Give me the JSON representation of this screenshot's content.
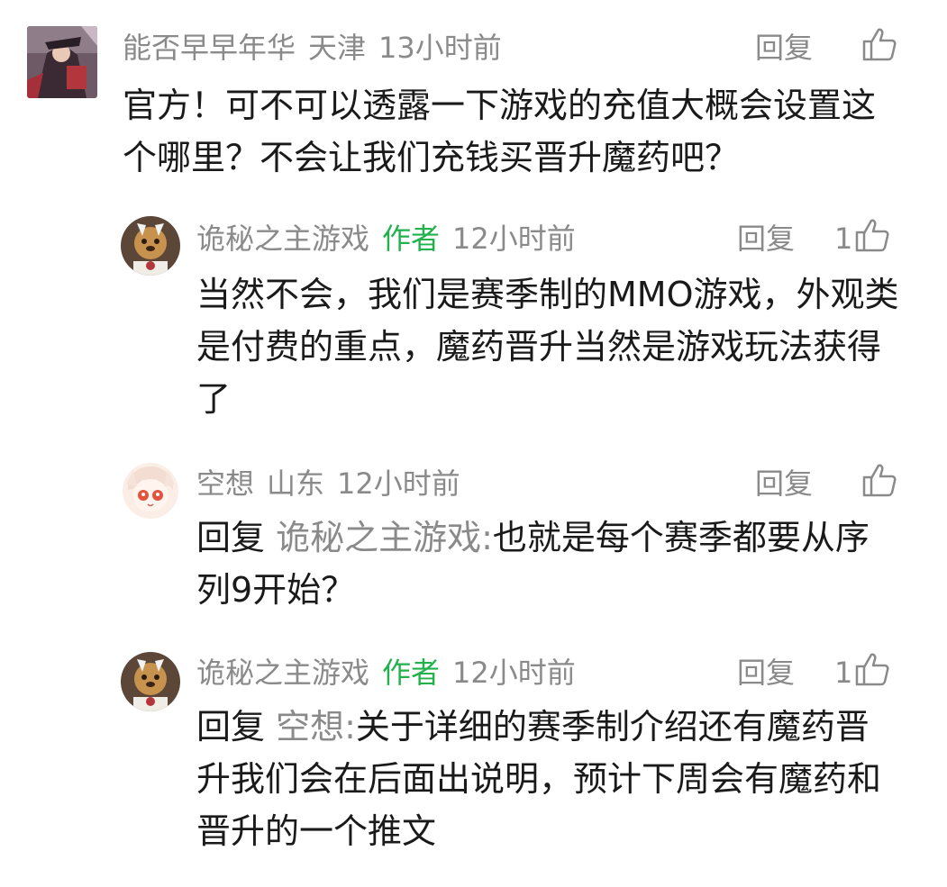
{
  "comments": [
    {
      "username": "能否早早年华",
      "location": "天津",
      "time": "13小时前",
      "reply_label": "回复",
      "like_count": "",
      "text": "官方！可不可以透露一下游戏的充值大概会设置这个哪里？不会让我们充钱买晋升魔药吧？"
    },
    {
      "username": "诡秘之主游戏",
      "author_tag": "作者",
      "time": "12小时前",
      "reply_label": "回复",
      "like_count": "1",
      "text": "当然不会，我们是赛季制的MMO游戏，外观类是付费的重点，魔药晋升当然是游戏玩法获得了"
    },
    {
      "username": "空想",
      "location": "山东",
      "time": "12小时前",
      "reply_label": "回复",
      "like_count": "",
      "reply_prefix": "回复",
      "reply_target": "诡秘之主游戏:",
      "text": "也就是每个赛季都要从序列9开始？"
    },
    {
      "username": "诡秘之主游戏",
      "author_tag": "作者",
      "time": "12小时前",
      "reply_label": "回复",
      "like_count": "1",
      "reply_prefix": "回复",
      "reply_target": "空想:",
      "text": "关于详细的赛季制介绍还有魔药晋升我们会在后面出说明，预计下周会有魔药和晋升的一个推文"
    }
  ],
  "colors": {
    "meta": "#8a8a8a",
    "author_tag": "#22b14c",
    "text": "#1a1a1a"
  },
  "icons": {
    "like": "thumbs-up-icon"
  }
}
